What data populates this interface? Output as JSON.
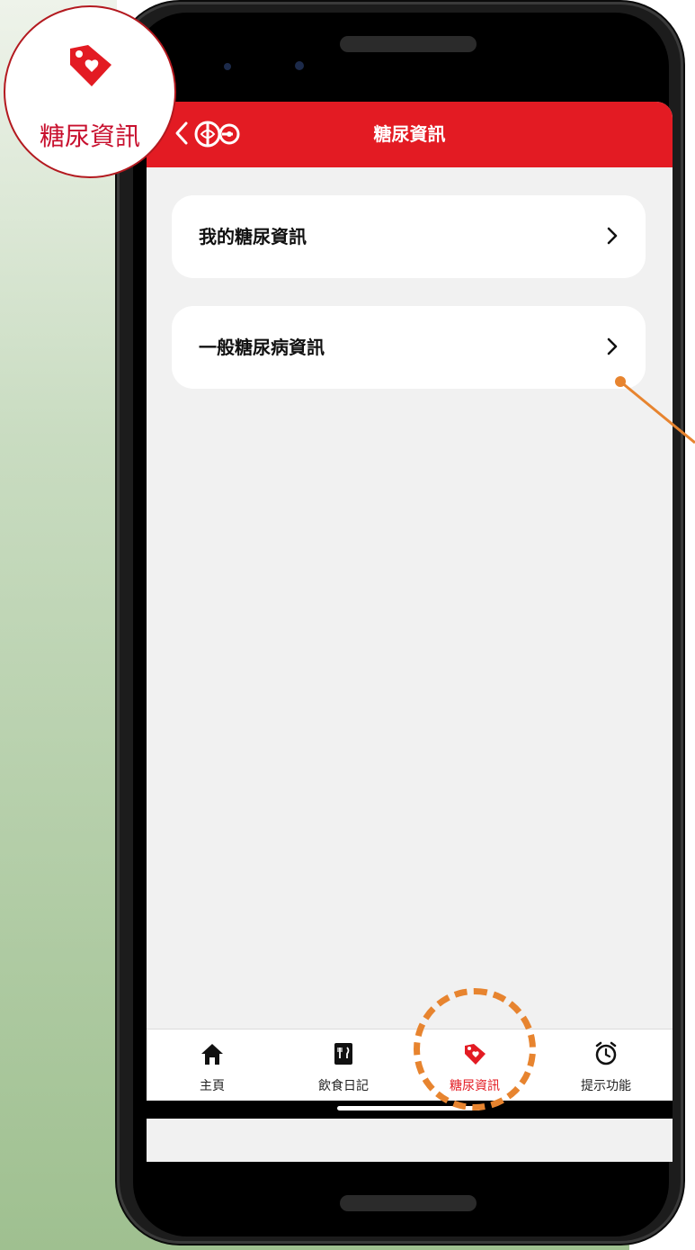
{
  "appbar": {
    "title": "糖尿資訊"
  },
  "menu": {
    "items": [
      {
        "label": "我的糖尿資訊",
        "icon": "chevron-right-icon"
      },
      {
        "label": "一般糖尿病資訊",
        "icon": "chevron-right-icon"
      }
    ]
  },
  "bottom_nav": {
    "items": [
      {
        "label": "主頁",
        "icon": "home-icon"
      },
      {
        "label": "飲食日記",
        "icon": "food-diary-icon"
      },
      {
        "label": "糖尿資訊",
        "icon": "heart-tag-icon",
        "active": true
      },
      {
        "label": "提示功能",
        "icon": "alarm-clock-icon"
      }
    ]
  },
  "callout": {
    "label": "糖尿資訊",
    "icon": "heart-tag-icon"
  },
  "colors": {
    "brand_red": "#e31b23",
    "annotation_orange": "#e7842f",
    "screen_background": "#f1f1f1"
  }
}
